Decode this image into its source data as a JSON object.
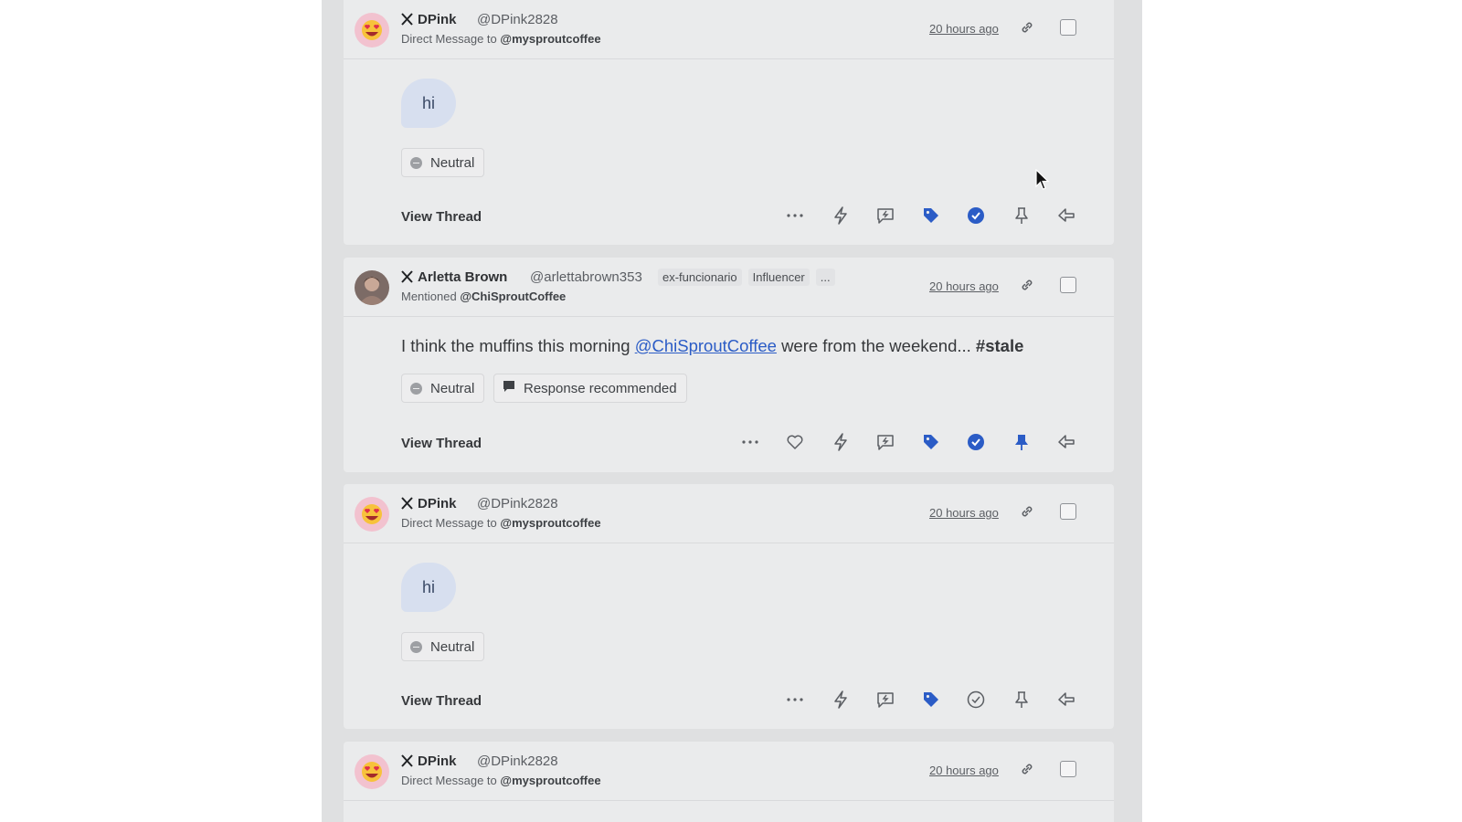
{
  "colors": {
    "accent": "#2b5cc6",
    "icon_gray": "#5b5e63"
  },
  "cards": [
    {
      "author_name": "DPink",
      "author_handle": "@DPink2828",
      "context_prefix": "Direct Message to",
      "context_account": "@mysproutcoffee",
      "timestamp": "20 hours ago",
      "message": "hi",
      "chip_sentiment": "Neutral",
      "view_thread": "View Thread",
      "actions": [
        "more-icon",
        "lightning-icon",
        "reply-message-icon",
        "tag-icon",
        "complete-icon",
        "pin-icon",
        "reply-icon"
      ],
      "complete_active": true,
      "pin_active": false
    },
    {
      "author_name": "Arletta Brown",
      "author_handle": "@arlettabrown353",
      "tags": [
        "ex-funcionario",
        "Influencer",
        "..."
      ],
      "context_prefix": "Mentioned",
      "context_account": "@ChiSproutCoffee",
      "timestamp": "20 hours ago",
      "message_before": "I think the muffins this morning",
      "message_mention": "@ChiSproutCoffee",
      "message_after": "were from the weekend...",
      "message_hashtag": "#stale",
      "chip_sentiment": "Neutral",
      "chip_response": "Response recommended",
      "view_thread": "View Thread",
      "actions": [
        "more-icon",
        "heart-icon",
        "lightning-icon",
        "reply-message-icon",
        "tag-icon",
        "complete-icon",
        "pin-icon",
        "reply-icon"
      ],
      "complete_active": true,
      "pin_active": true
    },
    {
      "author_name": "DPink",
      "author_handle": "@DPink2828",
      "context_prefix": "Direct Message to",
      "context_account": "@mysproutcoffee",
      "timestamp": "20 hours ago",
      "message": "hi",
      "chip_sentiment": "Neutral",
      "view_thread": "View Thread",
      "actions": [
        "more-icon",
        "lightning-icon",
        "reply-message-icon",
        "tag-icon",
        "complete-icon",
        "pin-icon",
        "reply-icon"
      ],
      "complete_active": false,
      "pin_active": false
    },
    {
      "author_name": "DPink",
      "author_handle": "@DPink2828",
      "context_prefix": "Direct Message to",
      "context_account": "@mysproutcoffee",
      "timestamp": "20 hours ago"
    }
  ]
}
